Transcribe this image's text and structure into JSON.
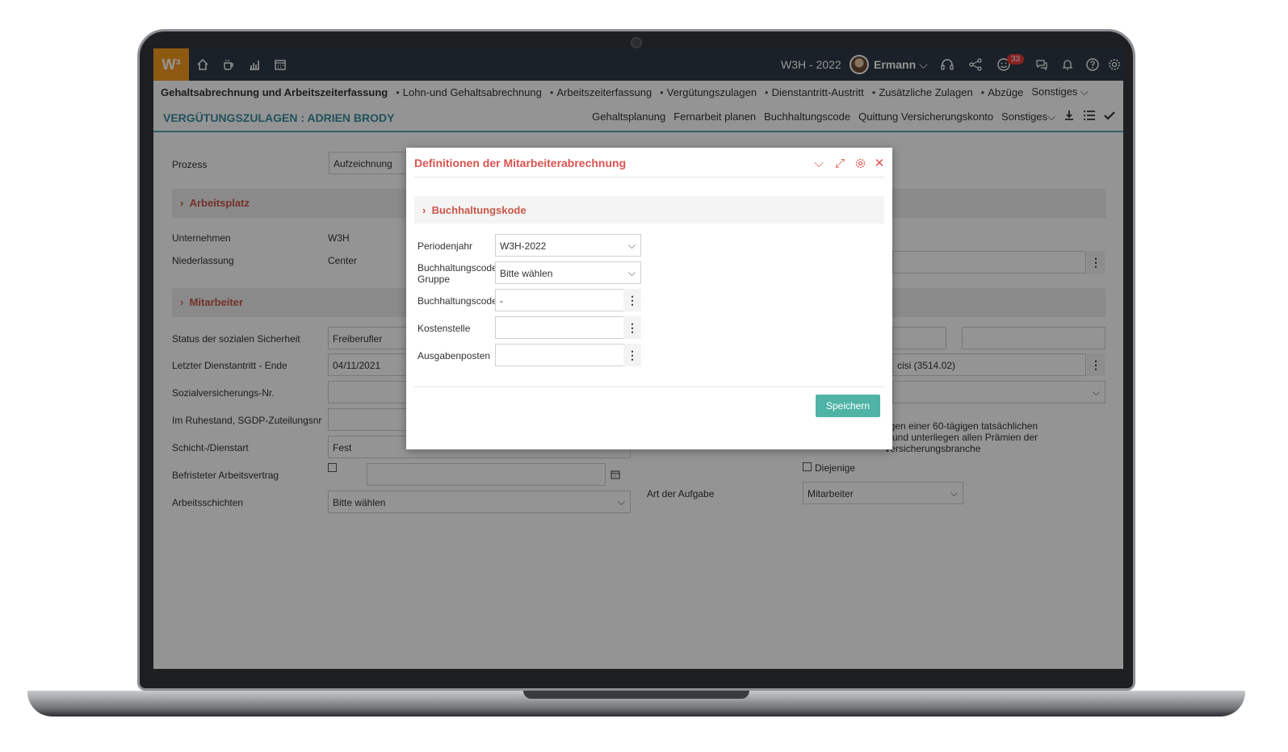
{
  "topbar": {
    "logo": "W³",
    "company_year": "W3H - 2022",
    "user_name": "Ermann",
    "notification_count": "33"
  },
  "nav": {
    "items": [
      {
        "label": "Gehaltsabrechnung und Arbeitszeiterfassung"
      },
      {
        "label": "Lohn-und Gehaltsabrechnung"
      },
      {
        "label": "Arbeitszeiterfassung"
      },
      {
        "label": "Vergütungszulagen"
      },
      {
        "label": "Dienstantritt-Austritt"
      },
      {
        "label": "Zusätzliche Zulagen"
      },
      {
        "label": "Abzüge"
      },
      {
        "label": "Sonstiges"
      }
    ]
  },
  "subheader": {
    "title": "VERGÜTUNGSZULAGEN : ADRIEN BRODY",
    "links": [
      "Gehaltsplanung",
      "Fernarbeit planen",
      "Buchhaltungscode",
      "Quittung Versicherungskonto",
      "Sonstiges"
    ]
  },
  "form": {
    "prozess_label": "Prozess",
    "prozess_value": "Aufzeichnung",
    "section_arbeitsplatz": "Arbeitsplatz",
    "unternehmen_label": "Unternehmen",
    "unternehmen_value": "W3H",
    "niederlassung_label": "Niederlassung",
    "niederlassung_value": "Center",
    "section_mitarbeiter": "Mitarbeiter",
    "status_label": "Status der sozialen Sicherheit",
    "status_value": "Freiberufler",
    "letzter_label": "Letzter Dienstantritt - Ende",
    "letzter_value": "04/11/2021",
    "svnr_label": "Sozialversicherungs-Nr.",
    "ruhestand_label": "Im Ruhestand, SGDP-Zuteilungsnr",
    "schicht_label": "Schicht-/Dienstart",
    "schicht_value": "Fest",
    "befristet_label": "Befristeter Arbeitsvertrag",
    "arbeitsschichten_label": "Arbeitsschichten",
    "arbeitsschichten_value": "Bitte wählen",
    "right_code_value": "cisi (3514.02)",
    "note_line1": "egen einer 60-tägigen tatsächlichen",
    "note_line2": "g und unterliegen allen Prämien der",
    "note_line3": "Versicherungsbranche",
    "diejenige_label": "Diejenige",
    "art_label": "Art der Aufgabe",
    "art_value": "Mitarbeiter"
  },
  "modal": {
    "title": "Definitionen der Mitarbeiterabrechnung",
    "section": "Buchhaltungskode",
    "periodenjahr_label": "Periodenjahr",
    "periodenjahr_value": "W3H-2022",
    "gruppe_label_1": "Buchhaltungscode",
    "gruppe_label_2": "Gruppe",
    "gruppe_value": "Bitte wählen",
    "code_label": "Buchhaltungscode",
    "code_value": "-",
    "kostenstelle_label": "Kostenstelle",
    "ausgabenposten_label": "Ausgabenposten",
    "save_label": "Speichern"
  },
  "colors": {
    "topbar": "#2e3a45",
    "logo": "#f39a1e",
    "title_teal": "#3a8e9c",
    "section_red": "#c9574a",
    "save_button": "#4fb3a6",
    "badge": "#e53935"
  }
}
